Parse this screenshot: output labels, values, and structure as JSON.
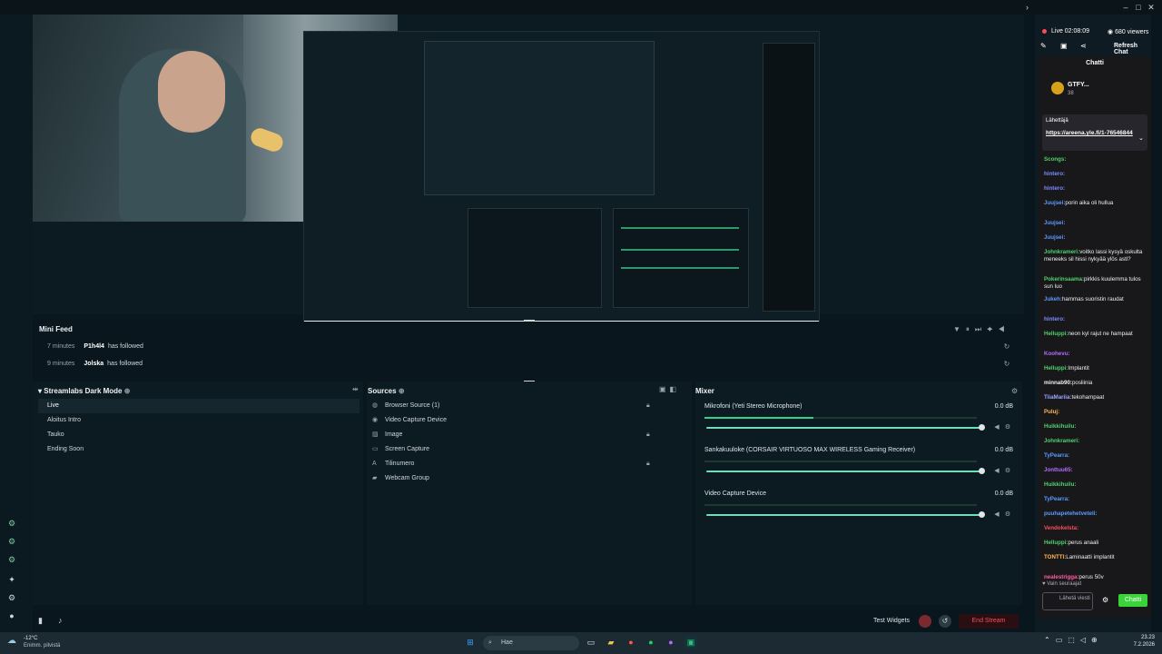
{
  "stream_status": {
    "live_label": "Live 02:08:09",
    "viewers": "680 viewers",
    "refresh_label": "Refresh Chat"
  },
  "chat_panel": {
    "title": "Chatti",
    "send_placeholder": "Lähetä viesti",
    "send_button": "Chatti",
    "followers_only": "Vain seuraajat",
    "pinned_link": "https://areena.yle.fi/1-76546844",
    "pinned_label": "Lähettäjä",
    "top_gifter": "GTFY...",
    "top_gifter_count": "38",
    "messages": [
      {
        "user": "Scongs:",
        "text": "",
        "color": "#4fd26b"
      },
      {
        "user": "hintero:",
        "text": "",
        "color": "#7b8cff"
      },
      {
        "user": "hintero:",
        "text": "",
        "color": "#7b8cff"
      },
      {
        "user": "Juujsei:",
        "text": "porin aika oli hullua",
        "color": "#5b9bff"
      },
      {
        "user": "Juujsei:",
        "text": "",
        "color": "#5b9bff"
      },
      {
        "user": "Juujsei:",
        "text": "",
        "color": "#5b9bff"
      },
      {
        "user": "Johnkrameri:",
        "text": "voitko lassi kysyä oskulta meneeks sil hissi nykyää ylös asti?",
        "color": "#4fd26b"
      },
      {
        "user": "Pokerinsaama:",
        "text": "pirkkis kuulemma tulos sun luo",
        "color": "#4fd26b"
      },
      {
        "user": "Jukeh:",
        "text": "hammas suoristin raudat",
        "color": "#5b9bff"
      },
      {
        "user": "hintero:",
        "text": "",
        "color": "#7b8cff"
      },
      {
        "user": "Helluppi:",
        "text": "neon kyl rajut ne hampaat",
        "color": "#4fd26b"
      },
      {
        "user": "Koohevu:",
        "text": "",
        "color": "#b36bff"
      },
      {
        "user": "Helluppi:",
        "text": "Implantit",
        "color": "#4fd26b"
      },
      {
        "user": "minnab90:",
        "text": "posliinia",
        "color": "#efeff1"
      },
      {
        "user": "TiiaMariia:",
        "text": "tekohampaat",
        "color": "#9aa7ff"
      },
      {
        "user": "Puluj:",
        "text": "",
        "color": "#ffb84d"
      },
      {
        "user": "Huikkihuilu:",
        "text": "",
        "color": "#4fd26b"
      },
      {
        "user": "Johnkrameri:",
        "text": "",
        "color": "#4fd26b"
      },
      {
        "user": "TyPearra:",
        "text": "",
        "color": "#5b9bff"
      },
      {
        "user": "Jonttuu65:",
        "text": "",
        "color": "#b36bff"
      },
      {
        "user": "Huikkihuilu:",
        "text": "",
        "color": "#4fd26b"
      },
      {
        "user": "TyPearra:",
        "text": "",
        "color": "#5b9bff"
      },
      {
        "user": "puuhapetehetveteli:",
        "text": "",
        "color": "#5b9bff"
      },
      {
        "user": "Vendokelsta:",
        "text": "",
        "color": "#ff4b55"
      },
      {
        "user": "Helluppi:",
        "text": "perus anaali",
        "color": "#4fd26b"
      },
      {
        "user": "TONTTI:",
        "text": "Laminaatti implantit",
        "color": "#ffb84d"
      },
      {
        "user": "nealestrigga:",
        "text": "perus 50v",
        "color": "#ff5ca8"
      }
    ]
  },
  "mini_feed": {
    "title": "Mini Feed",
    "rows": [
      {
        "time": "7 minutes",
        "user": "P1h4l4",
        "action": "has followed"
      },
      {
        "time": "9 minutes",
        "user": "Jolska",
        "action": "has followed"
      }
    ]
  },
  "scenes": {
    "title": "Streamlabs Dark Mode",
    "items": [
      "Live",
      "Aloitus Intro",
      "Tauko",
      "Ending Soon"
    ]
  },
  "sources": {
    "title": "Sources",
    "items": [
      {
        "label": "Browser Source (1)",
        "icon": "globe-icon"
      },
      {
        "label": "Video Capture Device",
        "icon": "camera-icon"
      },
      {
        "label": "Image",
        "icon": "image-icon"
      },
      {
        "label": "Screen Capture",
        "icon": "screen-icon"
      },
      {
        "label": "Tilinumero",
        "icon": "text-icon"
      },
      {
        "label": "Webcam Group",
        "icon": "folder-icon"
      }
    ]
  },
  "mixer": {
    "title": "Mixer",
    "channels": [
      {
        "name": "Mikrofoni (Yeti Stereo Microphone)",
        "db": "0.0 dB",
        "level": 0.4
      },
      {
        "name": "Sankakuuloke (CORSAIR VIRTUOSO MAX WIRELESS Gaming Receiver)",
        "db": "0.0 dB",
        "level": 0.0
      },
      {
        "name": "Video Capture Device",
        "db": "0.0 dB",
        "level": 0.0
      }
    ]
  },
  "bottom_bar": {
    "test_widgets": "Test Widgets",
    "end_stream": "End Stream"
  },
  "taskbar": {
    "weather_temp": "-12°C",
    "weather_desc": "Enimm. pilvistä",
    "search_placeholder": "Hae",
    "time": "23.23",
    "date": "7.2.2026"
  }
}
